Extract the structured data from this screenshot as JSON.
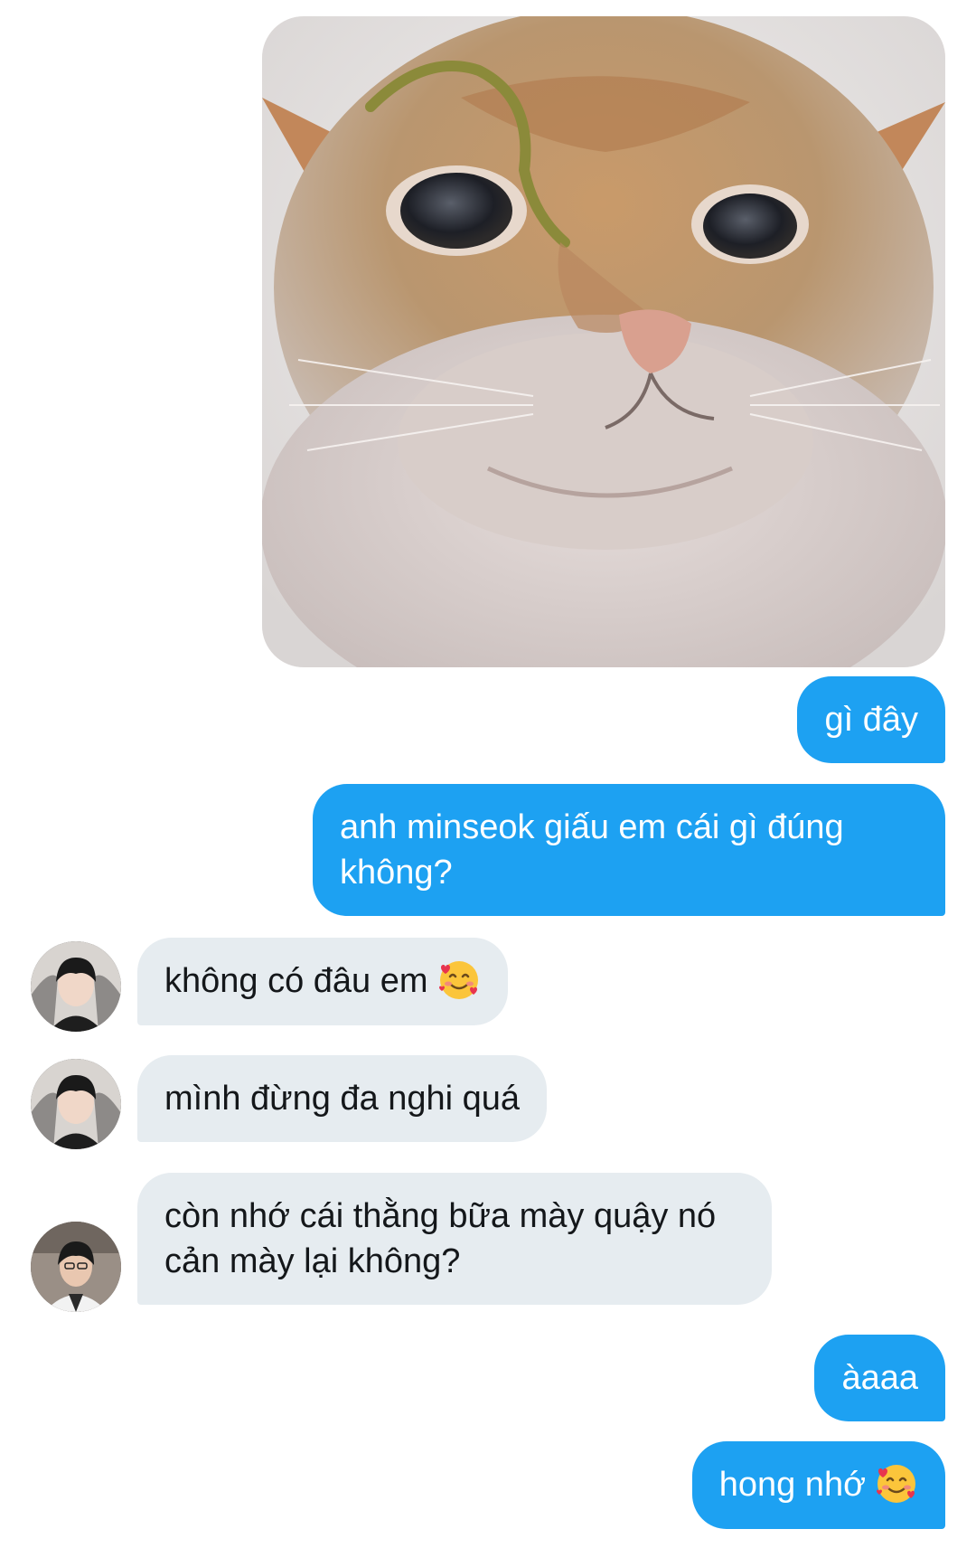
{
  "conversation": {
    "messages": [
      {
        "sender": "me",
        "type": "image",
        "image": "cat-closeup-photo"
      },
      {
        "sender": "me",
        "type": "text",
        "text": "gì đây"
      },
      {
        "sender": "me",
        "type": "text",
        "text": "anh minseok giấu em cái gì đúng không?"
      },
      {
        "sender": "other",
        "type": "text",
        "text": "không có đâu em",
        "emoji": "smiling-face-with-hearts-icon"
      },
      {
        "sender": "other",
        "type": "text",
        "text": "mình đừng đa nghi quá"
      },
      {
        "sender": "other2",
        "type": "text",
        "text": "còn nhớ cái thằng bữa mày quậy nó cản mày lại không?"
      },
      {
        "sender": "me",
        "type": "text",
        "text": "àaaa"
      },
      {
        "sender": "me",
        "type": "text",
        "text": "hong nhớ",
        "emoji": "smiling-face-with-hearts-icon"
      }
    ]
  },
  "colors": {
    "outgoing_bubble": "#1da1f2",
    "incoming_bubble": "#e6ecf0",
    "background": "#ffffff"
  }
}
